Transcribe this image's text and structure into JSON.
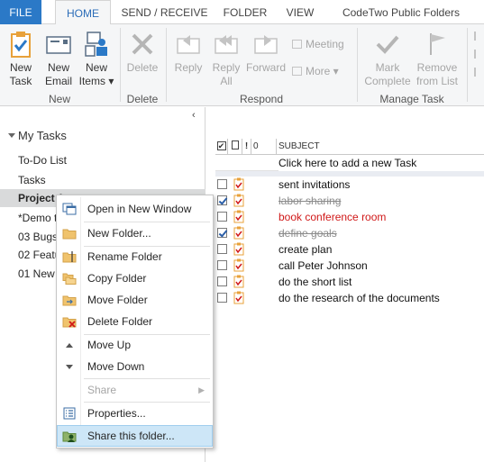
{
  "tabs": [
    {
      "label": "FILE"
    },
    {
      "label": "HOME"
    },
    {
      "label": "SEND / RECEIVE"
    },
    {
      "label": "FOLDER"
    },
    {
      "label": "VIEW"
    },
    {
      "label": "CodeTwo Public Folders"
    }
  ],
  "ribbon": {
    "new_task": [
      "New",
      "Task"
    ],
    "new_email": [
      "New",
      "Email"
    ],
    "new_items": [
      "New",
      "Items ▾"
    ],
    "delete": "Delete",
    "reply": "Reply",
    "reply_all": [
      "Reply",
      "All"
    ],
    "forward": "Forward",
    "meeting": "Meeting",
    "more": "More ▾",
    "mark_complete": [
      "Mark",
      "Complete"
    ],
    "remove_from_list": [
      "Remove",
      "from List"
    ],
    "groups": {
      "new": "New",
      "delete": "Delete",
      "respond": "Respond",
      "manage_task": "Manage Task"
    }
  },
  "nav": {
    "collapse": "‹",
    "section": "My Tasks",
    "folders": [
      "To-Do List",
      "Tasks",
      "Project 1",
      "*Demo t",
      "03 Bugs",
      "02 Featu",
      "01 New"
    ]
  },
  "task_list": {
    "header": {
      "subject": "SUBJECT",
      "col_check": "✔",
      "col_icon": "🗋",
      "col_priority": "!",
      "col_attach": "0"
    },
    "new_task_placeholder": "Click here to add a new Task",
    "rows": [
      {
        "subject": "sent invitations",
        "checked": false,
        "state": "normal"
      },
      {
        "subject": "labor sharing",
        "checked": true,
        "state": "done"
      },
      {
        "subject": "book conference room",
        "checked": false,
        "state": "overdue"
      },
      {
        "subject": "define goals",
        "checked": true,
        "state": "done"
      },
      {
        "subject": "create plan",
        "checked": false,
        "state": "normal"
      },
      {
        "subject": "call Peter Johnson",
        "checked": false,
        "state": "normal"
      },
      {
        "subject": "do the short list",
        "checked": false,
        "state": "normal"
      },
      {
        "subject": "do the research of the documents",
        "checked": false,
        "state": "normal"
      }
    ]
  },
  "context_menu": {
    "items": [
      {
        "label": "Open in New Window",
        "icon": "open-window-icon"
      },
      {
        "label": "New Folder...",
        "icon": "folder-icon"
      },
      {
        "label": "Rename Folder",
        "icon": "rename-folder-icon"
      },
      {
        "label": "Copy Folder",
        "icon": "copy-folder-icon"
      },
      {
        "label": "Move Folder",
        "icon": "move-folder-icon"
      },
      {
        "label": "Delete Folder",
        "icon": "delete-folder-icon"
      },
      {
        "label": "Move Up",
        "icon": "triangle-up-icon"
      },
      {
        "label": "Move Down",
        "icon": "triangle-down-icon"
      },
      {
        "label": "Share",
        "icon": "",
        "disabled": true,
        "submenu": true
      },
      {
        "label": "Properties...",
        "icon": "properties-icon"
      },
      {
        "label": "Share this folder...",
        "icon": "share-folder-icon",
        "highlighted": true
      }
    ]
  },
  "colors": {
    "file_tab": "#2b79c7",
    "active_tab_text": "#2b6cb8",
    "overdue": "#d01818",
    "menu_highlight": "#cde6f7",
    "task_icon_orange": "#e8a13a"
  }
}
